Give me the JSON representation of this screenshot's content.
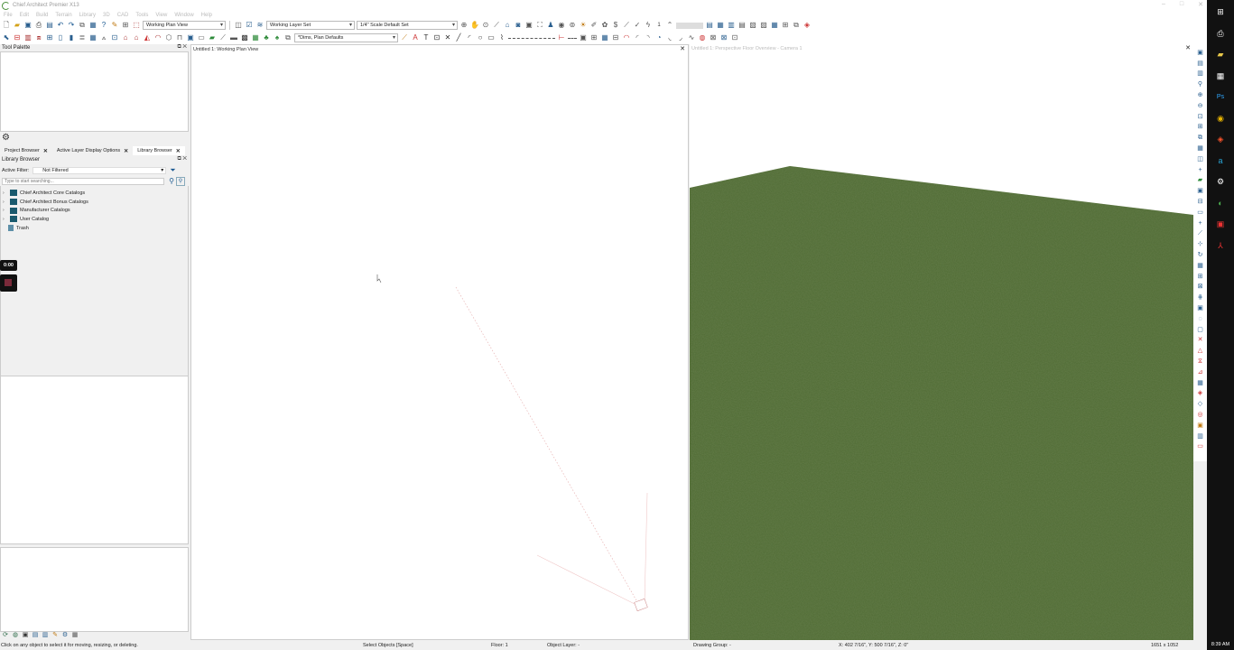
{
  "window": {
    "title": "Chief Architect Premier X13",
    "controls": [
      "–",
      "□",
      "✕"
    ]
  },
  "menu": [
    "File",
    "Edit",
    "Build",
    "Terrain",
    "Library",
    "3D",
    "CAD",
    "Tools",
    "View",
    "Window",
    "Help"
  ],
  "toolbar": {
    "view_combo": "Working Plan View",
    "layer_set_combo": "Working Layer Set",
    "scale_combo": "1/4\" Scale Default Set",
    "dims_combo": "*Dims, Plan Defaults",
    "number_one": "1"
  },
  "tool_palette": {
    "title": "Tool Palette",
    "controls": "⧉ ✕"
  },
  "tabs": [
    {
      "label": "Project Browser",
      "close": "✕"
    },
    {
      "label": "Active Layer Display Options",
      "close": "✕"
    },
    {
      "label": "Library Browser",
      "close": "✕"
    }
  ],
  "library_browser": {
    "title": "Library Browser",
    "controls": "⧉ ✕",
    "filter_label": "Active Filter:",
    "filter_value": "Not Filtered",
    "search_placeholder": "Type to start searching...",
    "items": [
      {
        "label": "Chief Architect Core Catalogs",
        "type": "folder"
      },
      {
        "label": "Chief Architect Bonus Catalogs",
        "type": "folder"
      },
      {
        "label": "Manufacturer Catalogs",
        "type": "folder"
      },
      {
        "label": "User Catalog",
        "type": "folder"
      },
      {
        "label": "Trash",
        "type": "trash"
      }
    ]
  },
  "recorder": {
    "time": "0:00"
  },
  "plan_view": {
    "title": "Untitled 1:  Working Plan View",
    "close": "✕"
  },
  "view3d": {
    "title": "Untitled 1: Perspective Floor Overview - Camera 1",
    "close": "✕",
    "ground_color": "#4f6b34"
  },
  "statusbar": {
    "hint": "Click on any object to select it for moving, resizing, or deleting.",
    "mode": "Select Objects [Space]",
    "floor": "Floor: 1",
    "object_layer": "Object Layer: -",
    "drawing_group": "Drawing Group: -",
    "coords": "X: 402 7/16\", Y: 500 7/16\", Z: 0\"",
    "size": "1651 x 1052"
  },
  "taskbar": {
    "time": "8:39 AM"
  }
}
